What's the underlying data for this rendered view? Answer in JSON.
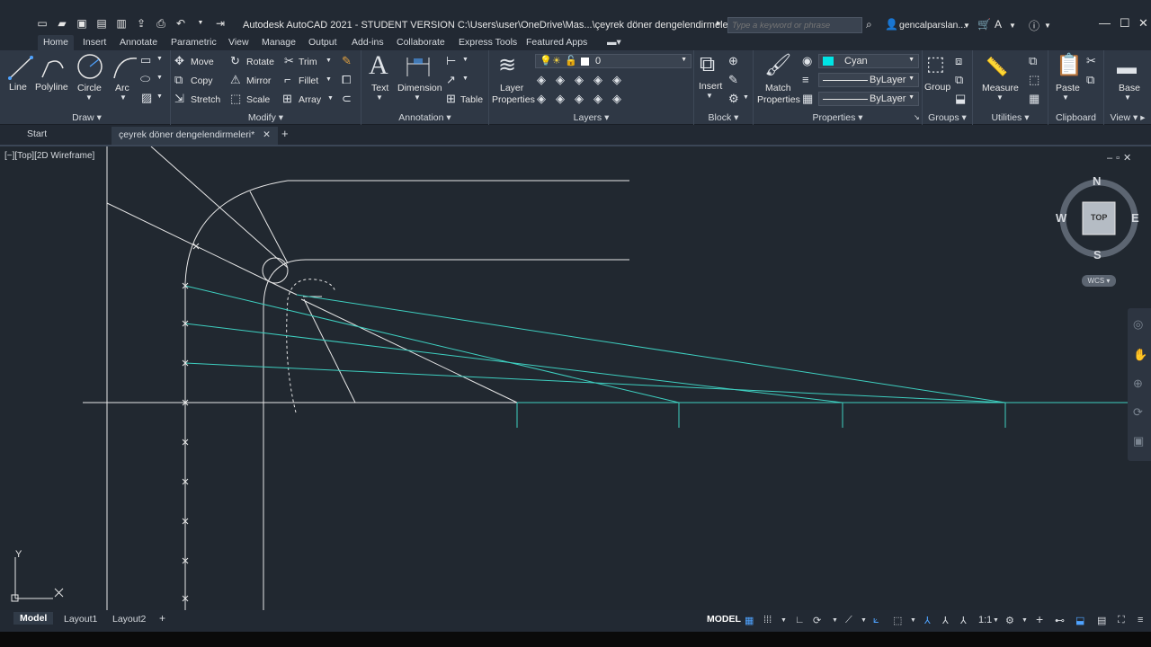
{
  "title_bar": {
    "title": "Autodesk AutoCAD 2021 - STUDENT VERSION    C:\\Users\\user\\OneDrive\\Mas...\\çeyrek döner dengelendirmeleri.dwg",
    "search_placeholder": "Type a keyword or phrase",
    "user": "gencalparslan..."
  },
  "menu_tabs": [
    "Home",
    "Insert",
    "Annotate",
    "Parametric",
    "View",
    "Manage",
    "Output",
    "Add-ins",
    "Collaborate",
    "Express Tools",
    "Featured Apps"
  ],
  "ribbon": {
    "draw": {
      "title": "Draw",
      "line": "Line",
      "polyline": "Polyline",
      "circle": "Circle",
      "arc": "Arc"
    },
    "modify": {
      "title": "Modify",
      "move": "Move",
      "rotate": "Rotate",
      "trim": "Trim",
      "copy": "Copy",
      "mirror": "Mirror",
      "fillet": "Fillet",
      "stretch": "Stretch",
      "scale": "Scale",
      "array": "Array"
    },
    "annotation": {
      "title": "Annotation",
      "text": "Text",
      "dimension": "Dimension",
      "table": "Table"
    },
    "layers": {
      "title": "Layers",
      "layer_properties_1": "Layer",
      "layer_properties_2": "Properties",
      "current_layer": "0"
    },
    "block": {
      "title": "Block",
      "insert": "Insert"
    },
    "properties": {
      "title": "Properties",
      "match_1": "Match",
      "match_2": "Properties",
      "color": "Cyan",
      "color_hex": "#00e5e5",
      "linetype": "ByLayer",
      "lineweight": "ByLayer"
    },
    "groups": {
      "title": "Groups",
      "group": "Group"
    },
    "utilities": {
      "title": "Utilities",
      "measure": "Measure"
    },
    "clipboard": {
      "title": "Clipboard",
      "paste": "Paste"
    },
    "view": {
      "title": "View",
      "base": "Base"
    }
  },
  "file_tabs": {
    "start": "Start",
    "active": "çeyrek döner dengelendirmeleri*"
  },
  "viewport": {
    "label": "[−][Top][2D Wireframe]",
    "viewcube": {
      "n": "N",
      "s": "S",
      "e": "E",
      "w": "W",
      "face": "TOP",
      "ucs": "WCS"
    },
    "ucs_y": "Y"
  },
  "layout_tabs": [
    "Model",
    "Layout1",
    "Layout2"
  ],
  "status": {
    "model": "MODEL",
    "scale": "1:1"
  },
  "colors": {
    "accent": "#4fa3ff",
    "cyan_lines": "#3ecfc0",
    "white_lines": "#e8e8e8"
  }
}
